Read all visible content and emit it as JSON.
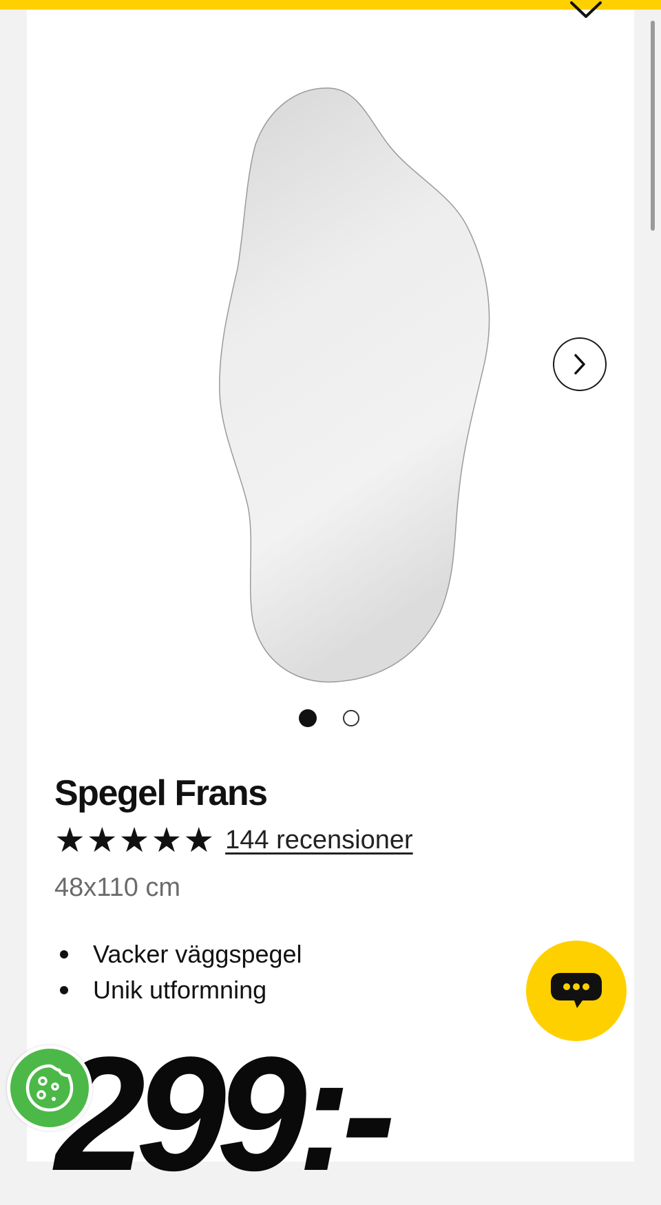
{
  "product": {
    "title": "Spegel Frans",
    "rating_value": 5,
    "rating_max": 5,
    "reviews_link": "144 recensioner",
    "dimensions": "48x110 cm",
    "features": [
      "Vacker väggspegel",
      "Unik utformning"
    ],
    "price": "299:-"
  },
  "gallery": {
    "image_count": 2,
    "active_index": 0
  },
  "icons": {
    "collapse": "chevron-down-icon",
    "next": "chevron-right-icon",
    "chat": "chat-bubble-icon",
    "cookie": "cookie-icon"
  },
  "colors": {
    "brand_yellow": "#ffd000",
    "cookie_green": "#4cb848",
    "text": "#111111",
    "muted_text": "#6b6b6b"
  }
}
